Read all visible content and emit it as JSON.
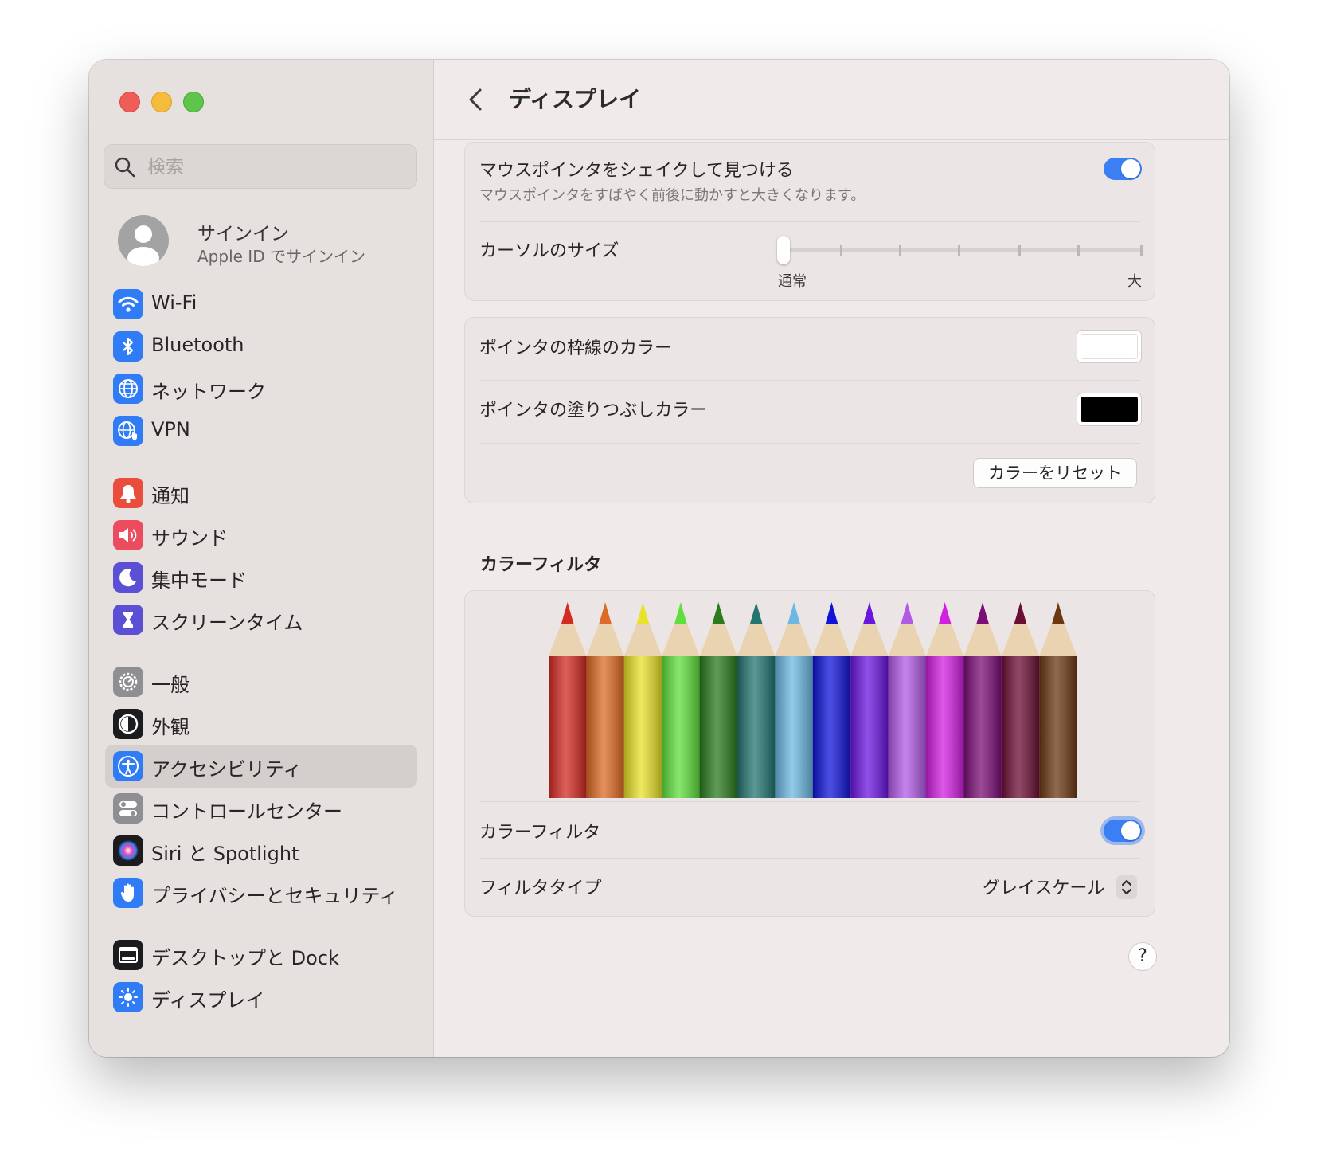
{
  "window": {
    "traffic_lights": [
      "close",
      "minimize",
      "zoom"
    ]
  },
  "sidebar": {
    "search_placeholder": "検索",
    "account": {
      "name": "サインイン",
      "subtitle": "Apple ID でサインイン"
    },
    "items": [
      {
        "label": "Wi-Fi",
        "icon": "wifi-icon",
        "color": "#2f7cf6"
      },
      {
        "label": "Bluetooth",
        "icon": "bluetooth-icon",
        "color": "#2f7cf6"
      },
      {
        "label": "ネットワーク",
        "icon": "globe-icon",
        "color": "#2f7cf6"
      },
      {
        "label": "VPN",
        "icon": "vpn-globe-icon",
        "color": "#2f7cf6"
      },
      {
        "label": "通知",
        "icon": "bell-icon",
        "color": "#eb4d3d"
      },
      {
        "label": "サウンド",
        "icon": "speaker-icon",
        "color": "#eb4d5e"
      },
      {
        "label": "集中モード",
        "icon": "moon-icon",
        "color": "#5b4fd6"
      },
      {
        "label": "スクリーンタイム",
        "icon": "hourglass-icon",
        "color": "#5b4fd6"
      },
      {
        "label": "一般",
        "icon": "gear-icon",
        "color": "#8e8e93"
      },
      {
        "label": "外観",
        "icon": "appearance-icon",
        "color": "#1c1c1e"
      },
      {
        "label": "アクセシビリティ",
        "icon": "accessibility-icon",
        "color": "#2f7cf6",
        "selected": true
      },
      {
        "label": "コントロールセンター",
        "icon": "toggles-icon",
        "color": "#8e8e93"
      },
      {
        "label": "Siri と Spotlight",
        "icon": "siri-icon",
        "color": "#1c1c1e"
      },
      {
        "label": "プライバシーとセキュリティ",
        "icon": "hand-icon",
        "color": "#2f7cf6"
      },
      {
        "label": "デスクトップと Dock",
        "icon": "dock-icon",
        "color": "#1c1c1e"
      },
      {
        "label": "ディスプレイ",
        "icon": "sun-icon",
        "color": "#2f7cf6"
      }
    ]
  },
  "main": {
    "title": "ディスプレイ",
    "shake": {
      "label": "マウスポインタをシェイクして見つける",
      "description": "マウスポインタをすばやく前後に動かすと大きくなります。",
      "enabled": true
    },
    "cursor_size": {
      "label": "カーソルのサイズ",
      "min_label": "通常",
      "max_label": "大",
      "value": 0
    },
    "outline_color": {
      "label": "ポインタの枠線のカラー",
      "color": "#ffffff"
    },
    "fill_color": {
      "label": "ポインタの塗りつぶしカラー",
      "color": "#000000"
    },
    "reset_button": "カラーをリセット",
    "color_filter_section": "カラーフィルタ",
    "pencil_colors": [
      "#d32a22",
      "#de6b25",
      "#e8e22a",
      "#5fdf3c",
      "#2a7a1e",
      "#237570",
      "#6cb8e2",
      "#1014d8",
      "#6b16e0",
      "#b25ae6",
      "#d21fe0",
      "#7a0e76",
      "#6b0e36",
      "#6b3812"
    ],
    "color_filter": {
      "label": "カラーフィルタ",
      "enabled": true
    },
    "filter_type": {
      "label": "フィルタタイプ",
      "value": "グレイスケール"
    },
    "help": "?"
  }
}
